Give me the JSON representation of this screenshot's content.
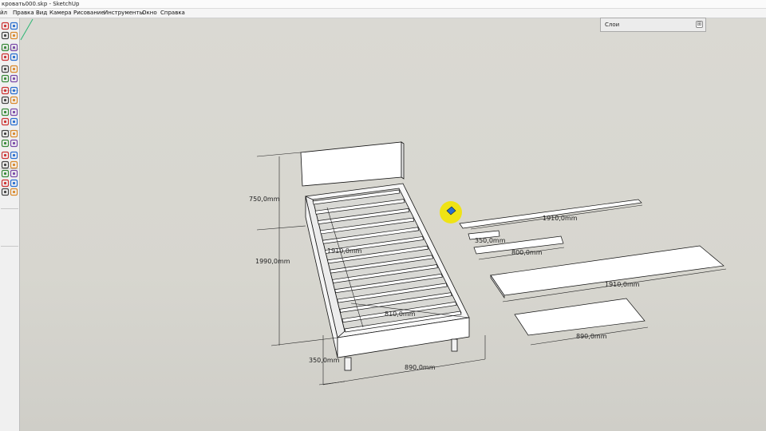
{
  "window": {
    "title": "кровать000.skp - SketchUp"
  },
  "menu": [
    {
      "label": "йл"
    },
    {
      "label": "Правка"
    },
    {
      "label": "Вид"
    },
    {
      "label": "Камера"
    },
    {
      "label": "Рисование"
    },
    {
      "label": "Инструменты"
    },
    {
      "label": "Окно"
    },
    {
      "label": "Справка"
    }
  ],
  "layers_panel": {
    "title": "Слои",
    "toggle_label": "⊞"
  },
  "dimensions": {
    "bed_height": "750,0mm",
    "bed_length": "1990,0mm",
    "leg_height": "350,0mm",
    "bed_width": "890,0mm",
    "inner_length": "1910,0mm",
    "inner_width": "810,0mm",
    "slat_long": "1910,0mm",
    "slat_short": "350,0mm",
    "slat_mid": "800,0mm",
    "board_long": "1910,0mm",
    "board_front": "890,0mm"
  },
  "colors": {
    "viewport_bg": "#d8d7d2",
    "face_white": "#ffffff",
    "edge": "#111111",
    "cursor_highlight": "#f2e400",
    "cursor_blue": "#2a6fd0",
    "axis_green": "#2bb673"
  },
  "toolbar_tools": [
    {
      "icon": "select-icon"
    },
    {
      "icon": "eraser-icon"
    },
    {
      "icon": "line-icon"
    },
    {
      "icon": "paint-bucket-icon"
    },
    {
      "icon": "rectangle-icon"
    },
    {
      "icon": "arc-icon"
    },
    {
      "icon": "circle-icon"
    },
    {
      "icon": "polygon-icon"
    },
    {
      "icon": "push-pull-icon"
    },
    {
      "icon": "follow-me-icon"
    },
    {
      "icon": "move-icon"
    },
    {
      "icon": "rotate-icon"
    },
    {
      "icon": "offset-icon"
    },
    {
      "icon": "scale-icon"
    },
    {
      "icon": "tape-measure-icon"
    },
    {
      "icon": "dimension-icon"
    },
    {
      "icon": "text-icon"
    },
    {
      "icon": "axes-icon"
    },
    {
      "icon": "protractor-icon"
    },
    {
      "icon": "3d-text-icon"
    },
    {
      "icon": "orbit-icon"
    },
    {
      "icon": "pan-icon"
    },
    {
      "icon": "zoom-icon"
    },
    {
      "icon": "zoom-window-icon"
    },
    {
      "icon": "zoom-extents-icon"
    },
    {
      "icon": "previous-view-icon"
    },
    {
      "icon": "walk-icon"
    },
    {
      "icon": "look-around-icon"
    },
    {
      "icon": "section-plane-icon"
    },
    {
      "icon": "position-camera-icon"
    },
    {
      "icon": "sandbox-icon"
    },
    {
      "icon": "components-icon"
    },
    {
      "icon": "materials-icon"
    },
    {
      "icon": "styles-icon"
    }
  ]
}
